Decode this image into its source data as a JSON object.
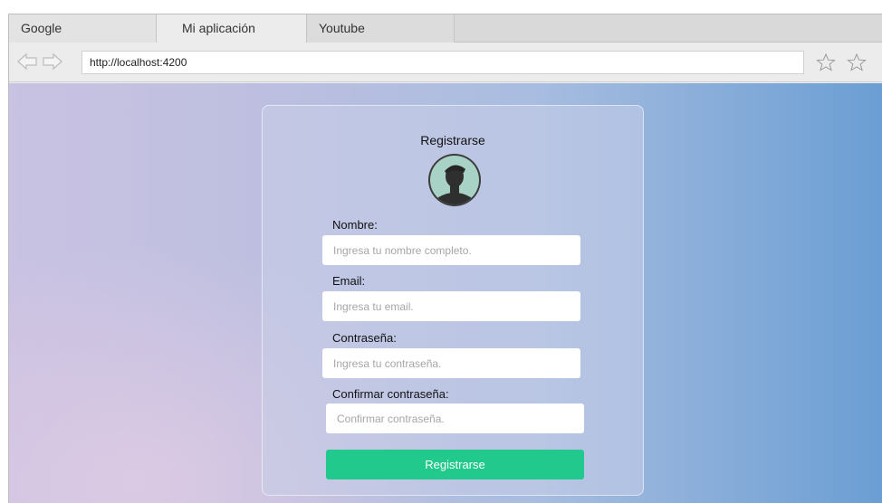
{
  "browser": {
    "tabs": [
      {
        "label": "Google"
      },
      {
        "label": "Mi aplicación"
      },
      {
        "label": "Youtube"
      }
    ],
    "url": "http://localhost:4200"
  },
  "form": {
    "title": "Registrarse",
    "fields": [
      {
        "label": "Nombre:",
        "placeholder": "Ingresa tu nombre completo."
      },
      {
        "label": "Email:",
        "placeholder": "Ingresa tu email."
      },
      {
        "label": "Contraseña:",
        "placeholder": "Ingresa tu contraseña."
      },
      {
        "label": "Confirmar contraseña:",
        "placeholder": "Confirmar contraseña."
      }
    ],
    "submit_label": "Registrarse"
  },
  "icons": {
    "back": "arrow-left-icon",
    "forward": "arrow-right-icon",
    "bookmark": "star-icon",
    "avatar": "user-avatar-icon"
  },
  "colors": {
    "button": "#22c98c",
    "avatar_bg": "#a9d2c6"
  }
}
